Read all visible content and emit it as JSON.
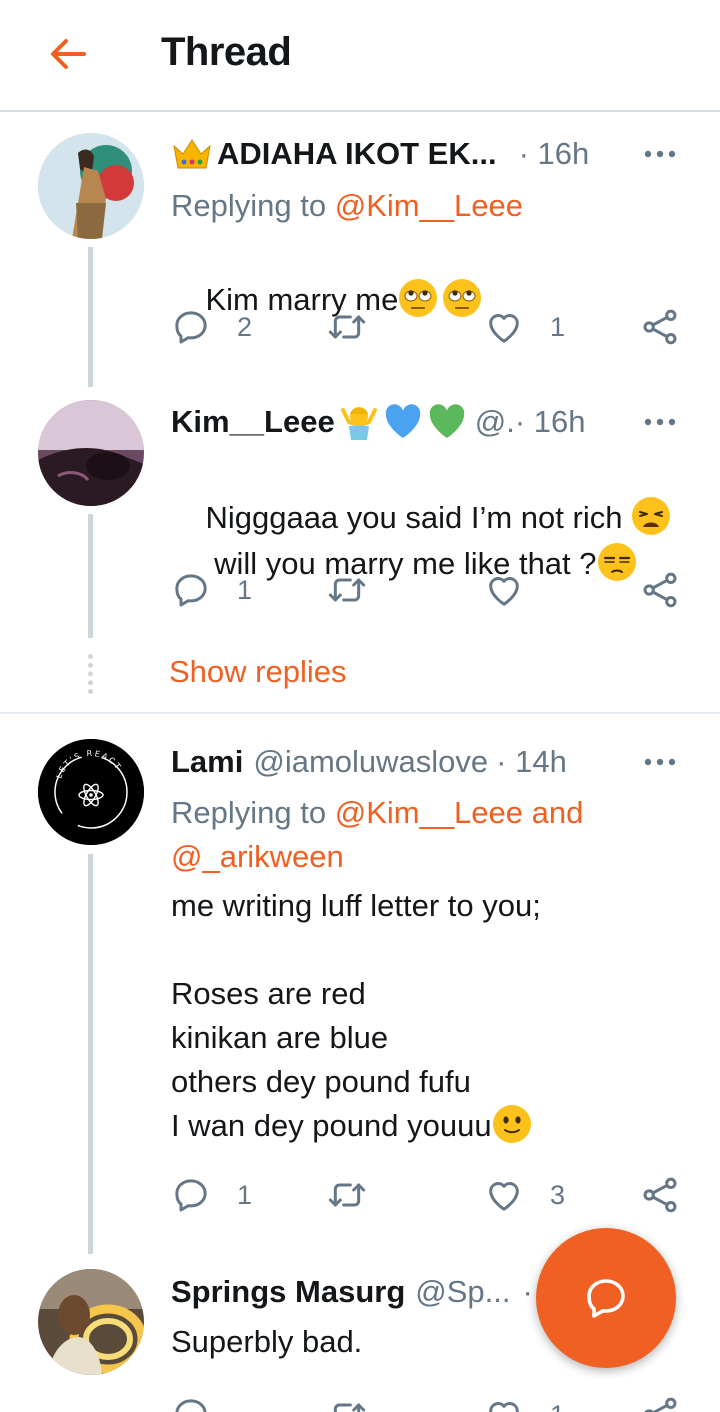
{
  "header": {
    "title": "Thread"
  },
  "tweets": [
    {
      "name": "ADIAHA IKOT EK...",
      "handle": "",
      "time": "· 16h",
      "reply_prefix": "Replying to ",
      "reply_targets": "@Kim__Leee",
      "reply_line2": "",
      "text": "Kim marry me",
      "replies": "2",
      "retweets": "",
      "likes": "1"
    },
    {
      "name": "Kim__Leee",
      "handle": "@.",
      "time": "· 16h",
      "text_line1": "Nigggaaa you said I’m not rich",
      "text_line2": " will you marry me like that ?",
      "replies": "1",
      "retweets": "",
      "likes": ""
    },
    {
      "name": "Lami",
      "handle": "@iamoluwaslove",
      "time": "· 14h",
      "reply_prefix": "Replying to ",
      "reply_targets": "@Kim__Leee and",
      "reply_line2": "@_arikween",
      "text": "me writing luff letter to you;\n\nRoses are red\nkinikan are blue\nothers dey pound fufu\nI wan dey pound youuu",
      "replies": "1",
      "retweets": "",
      "likes": "3"
    },
    {
      "name": "Springs Masurg",
      "handle": "@Sp...",
      "time": "·",
      "text": "Superbly bad.",
      "replies": "",
      "retweets": "",
      "likes": "1"
    }
  ],
  "show_replies": "Show replies",
  "avatar3_ring_text": "LET'S REACT",
  "colors": {
    "accent": "#f06022",
    "secondary_text": "#657786",
    "line": "#ccd6dd"
  },
  "icons": [
    "back-arrow-icon",
    "more-icon",
    "reply-icon",
    "retweet-icon",
    "like-icon",
    "share-icon",
    "compose-reply-icon"
  ]
}
